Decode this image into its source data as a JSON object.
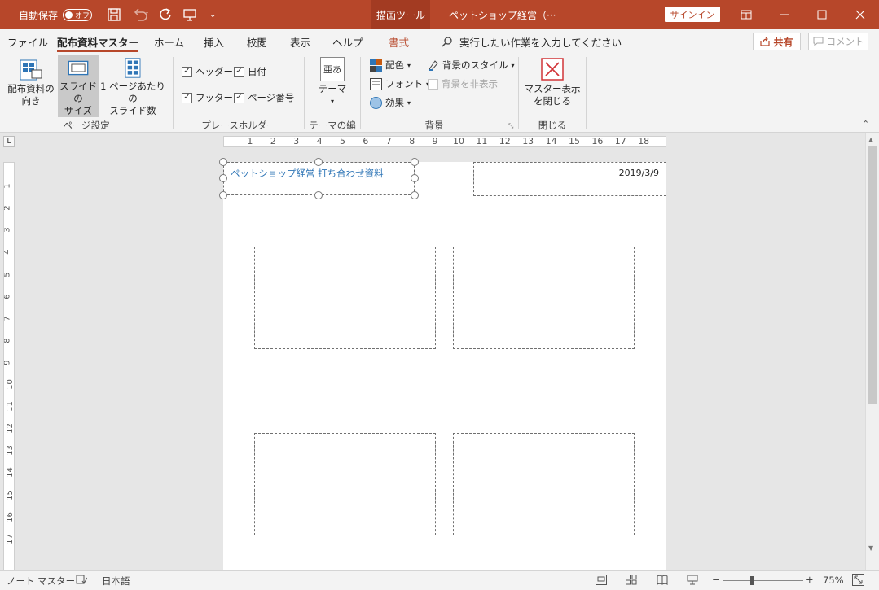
{
  "titlebar": {
    "autosave_label": "自動保存",
    "autosave_state": "オフ",
    "contextual_tab": "描画ツール",
    "document_title": "ペットショップ経営（···",
    "signin_label": "サインイン"
  },
  "tabs": [
    {
      "label": "ファイル"
    },
    {
      "label": "配布資料マスター"
    },
    {
      "label": "ホーム"
    },
    {
      "label": "挿入"
    },
    {
      "label": "校閲"
    },
    {
      "label": "表示"
    },
    {
      "label": "ヘルプ"
    },
    {
      "label": "書式"
    }
  ],
  "tell_me": "実行したい作業を入力してください",
  "share_label": "共有",
  "comment_label": "コメント",
  "ribbon": {
    "page_setup": {
      "orientation_label": "配布資料の\n向き",
      "slide_size_label": "スライドの\nサイズ",
      "slides_per_page_label": "1 ページあたりの\nスライド数",
      "group_label": "ページ設定"
    },
    "placeholders": {
      "header": "ヘッダー",
      "date": "日付",
      "footer": "フッター",
      "page_number": "ページ番号",
      "group_label": "プレースホルダー"
    },
    "theme": {
      "theme_label": "テーマ",
      "group_label": "テーマの編集",
      "icon_text": "亜あ"
    },
    "background": {
      "colors": "配色",
      "fonts": "フォント",
      "effects": "効果",
      "bg_styles": "背景のスタイル",
      "hide_bg": "背景を非表示",
      "group_label": "背景"
    },
    "close": {
      "close_label": "マスター表示\nを閉じる",
      "group_label": "閉じる"
    }
  },
  "ruler": {
    "h_numbers": [
      "1",
      "2",
      "3",
      "4",
      "5",
      "6",
      "7",
      "8",
      "9",
      "10",
      "11",
      "12",
      "13",
      "14",
      "15",
      "16",
      "17",
      "18"
    ],
    "v_numbers": [
      "1",
      "2",
      "3",
      "4",
      "5",
      "6",
      "7",
      "8",
      "9",
      "10",
      "11",
      "12",
      "13",
      "14",
      "15",
      "16",
      "17"
    ],
    "corner": "L"
  },
  "page": {
    "header_text": "ペットショップ経営  打ち合わせ資料",
    "date_text": "2019/3/9"
  },
  "status": {
    "view_name": "ノート マスター",
    "language": "日本語",
    "zoom": "75%",
    "zoom_out": "−",
    "zoom_in": "+"
  },
  "colors": {
    "accent": "#b7472a",
    "header_text": "#2e75b6"
  }
}
